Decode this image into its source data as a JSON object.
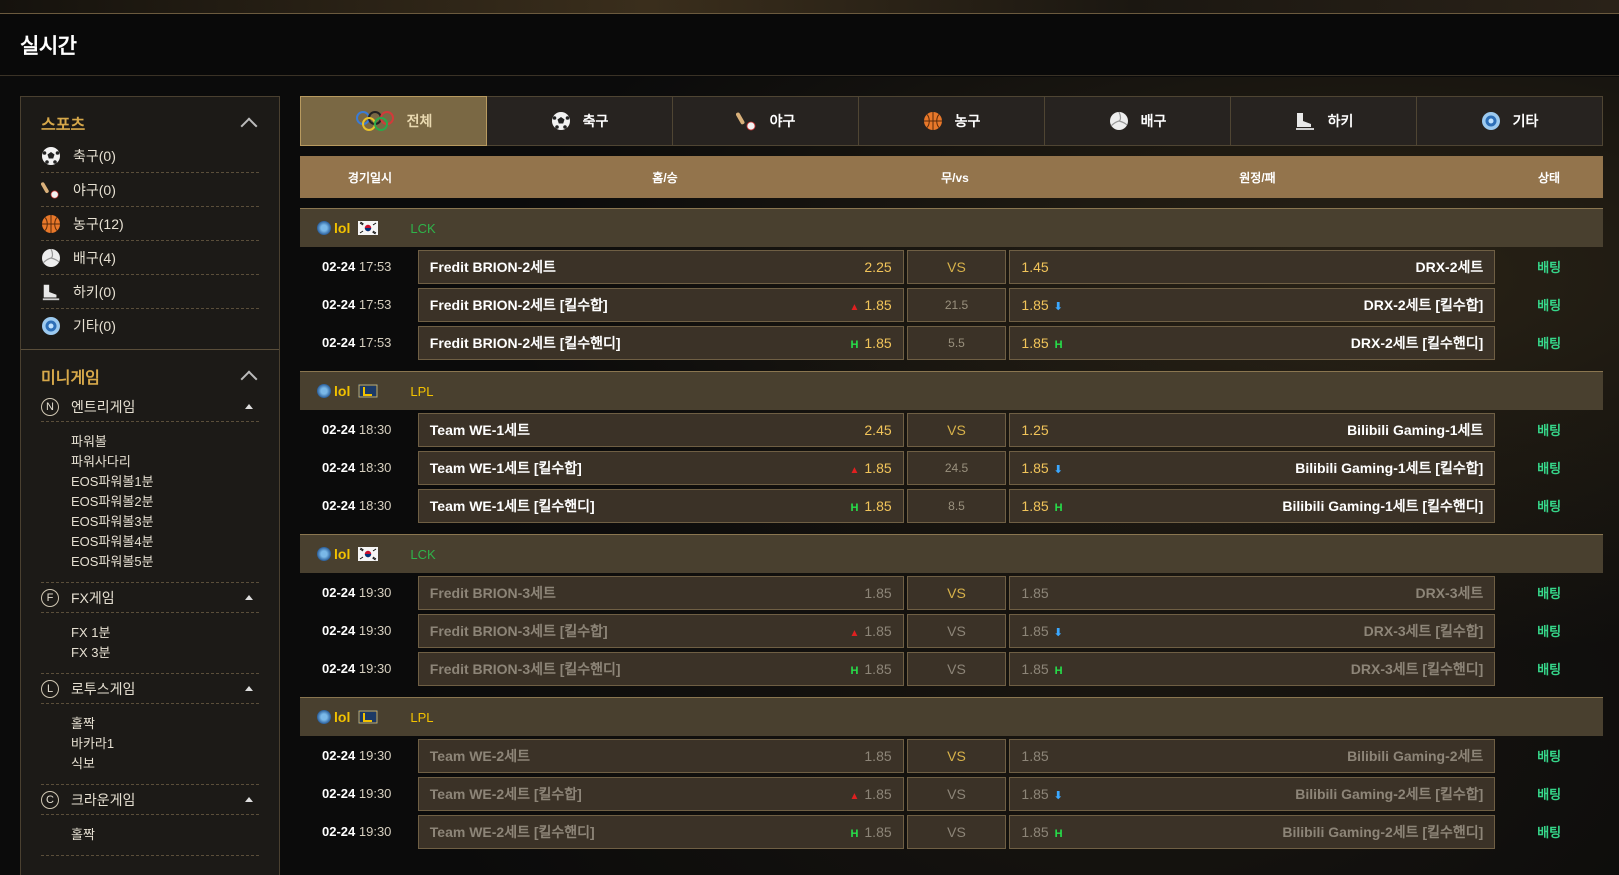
{
  "page": {
    "title": "실시간"
  },
  "sidebar": {
    "sports_title": "스포츠",
    "sports": [
      {
        "label": "축구(0)",
        "icon": "soccer-ball-icon"
      },
      {
        "label": "야구(0)",
        "icon": "baseball-icon"
      },
      {
        "label": "농구(12)",
        "icon": "basketball-icon"
      },
      {
        "label": "배구(4)",
        "icon": "volleyball-icon"
      },
      {
        "label": "하키(0)",
        "icon": "hockey-skate-icon"
      },
      {
        "label": "기타(0)",
        "icon": "etc-globe-icon"
      }
    ],
    "minigame_title": "미니게임",
    "minigames": [
      {
        "badge": "N",
        "label": "엔트리게임",
        "items": [
          "파워볼",
          "파워사다리",
          "EOS파워볼1분",
          "EOS파워볼2분",
          "EOS파워볼3분",
          "EOS파워볼4분",
          "EOS파워볼5분"
        ]
      },
      {
        "badge": "F",
        "label": "FX게임",
        "items": [
          "FX 1분",
          "FX 3분"
        ]
      },
      {
        "badge": "L",
        "label": "로투스게임",
        "items": [
          "홀짝",
          "바카라1",
          "식보"
        ]
      },
      {
        "badge": "C",
        "label": "크라운게임",
        "items": [
          "홀짝"
        ]
      }
    ]
  },
  "tabs": [
    {
      "label": "전체",
      "icon": "olympic-rings-icon",
      "active": true
    },
    {
      "label": "축구",
      "icon": "soccer-ball-icon"
    },
    {
      "label": "야구",
      "icon": "baseball-icon"
    },
    {
      "label": "농구",
      "icon": "basketball-icon"
    },
    {
      "label": "배구",
      "icon": "volleyball-icon"
    },
    {
      "label": "하키",
      "icon": "hockey-skate-icon"
    },
    {
      "label": "기타",
      "icon": "etc-globe-icon"
    }
  ],
  "table_header": {
    "date": "경기일시",
    "home": "홈/승",
    "draw": "무/vs",
    "away": "원정/패",
    "status": "상태"
  },
  "groups": [
    {
      "game": "lol",
      "league": "LCK",
      "league_color": "#2fb34a",
      "flag": "korea-flag-icon",
      "rows": [
        {
          "date": "02-24",
          "time": "17:53",
          "home": "Fredit BRION-2세트",
          "home_mark": "",
          "home_odd": "2.25",
          "mid": "VS",
          "away_odd": "1.45",
          "away_mark": "",
          "away": "DRX-2세트",
          "bet": "배팅",
          "dim": false
        },
        {
          "date": "02-24",
          "time": "17:53",
          "home": "Fredit BRION-2세트 [킬수합]",
          "home_mark": "▲",
          "home_odd": "1.85",
          "mid": "21.5",
          "away_odd": "1.85",
          "away_mark": "⬇",
          "away": "DRX-2세트 [킬수합]",
          "bet": "배팅",
          "dim": false
        },
        {
          "date": "02-24",
          "time": "17:53",
          "home": "Fredit BRION-2세트 [킬수핸디]",
          "home_mark": "H",
          "home_odd": "1.85",
          "mid": "5.5",
          "away_odd": "1.85",
          "away_mark": "H",
          "away": "DRX-2세트 [킬수핸디]",
          "bet": "배팅",
          "dim": false
        }
      ]
    },
    {
      "game": "lol",
      "league": "LPL",
      "league_color": "#f2c200",
      "flag": "lpl-logo-icon",
      "rows": [
        {
          "date": "02-24",
          "time": "18:30",
          "home": "Team WE-1세트",
          "home_mark": "",
          "home_odd": "2.45",
          "mid": "VS",
          "away_odd": "1.25",
          "away_mark": "",
          "away": "Bilibili Gaming-1세트",
          "bet": "배팅",
          "dim": false
        },
        {
          "date": "02-24",
          "time": "18:30",
          "home": "Team WE-1세트 [킬수합]",
          "home_mark": "▲",
          "home_odd": "1.85",
          "mid": "24.5",
          "away_odd": "1.85",
          "away_mark": "⬇",
          "away": "Bilibili Gaming-1세트 [킬수합]",
          "bet": "배팅",
          "dim": false
        },
        {
          "date": "02-24",
          "time": "18:30",
          "home": "Team WE-1세트 [킬수핸디]",
          "home_mark": "H",
          "home_odd": "1.85",
          "mid": "8.5",
          "away_odd": "1.85",
          "away_mark": "H",
          "away": "Bilibili Gaming-1세트 [킬수핸디]",
          "bet": "배팅",
          "dim": false
        }
      ]
    },
    {
      "game": "lol",
      "league": "LCK",
      "league_color": "#2fb34a",
      "flag": "korea-flag-icon",
      "rows": [
        {
          "date": "02-24",
          "time": "19:30",
          "home": "Fredit BRION-3세트",
          "home_mark": "",
          "home_odd": "1.85",
          "mid": "VS",
          "away_odd": "1.85",
          "away_mark": "",
          "away": "DRX-3세트",
          "bet": "배팅",
          "dim": true
        },
        {
          "date": "02-24",
          "time": "19:30",
          "home": "Fredit BRION-3세트 [킬수합]",
          "home_mark": "▲",
          "home_odd": "1.85",
          "mid": "VS",
          "away_odd": "1.85",
          "away_mark": "⬇",
          "away": "DRX-3세트 [킬수합]",
          "bet": "배팅",
          "dim": true
        },
        {
          "date": "02-24",
          "time": "19:30",
          "home": "Fredit BRION-3세트 [킬수핸디]",
          "home_mark": "H",
          "home_odd": "1.85",
          "mid": "VS",
          "away_odd": "1.85",
          "away_mark": "H",
          "away": "DRX-3세트 [킬수핸디]",
          "bet": "배팅",
          "dim": true
        }
      ]
    },
    {
      "game": "lol",
      "league": "LPL",
      "league_color": "#f2c200",
      "flag": "lpl-logo-icon",
      "rows": [
        {
          "date": "02-24",
          "time": "19:30",
          "home": "Team WE-2세트",
          "home_mark": "",
          "home_odd": "1.85",
          "mid": "VS",
          "away_odd": "1.85",
          "away_mark": "",
          "away": "Bilibili Gaming-2세트",
          "bet": "배팅",
          "dim": true
        },
        {
          "date": "02-24",
          "time": "19:30",
          "home": "Team WE-2세트 [킬수합]",
          "home_mark": "▲",
          "home_odd": "1.85",
          "mid": "VS",
          "away_odd": "1.85",
          "away_mark": "⬇",
          "away": "Bilibili Gaming-2세트 [킬수합]",
          "bet": "배팅",
          "dim": true
        },
        {
          "date": "02-24",
          "time": "19:30",
          "home": "Team WE-2세트 [킬수핸디]",
          "home_mark": "H",
          "home_odd": "1.85",
          "mid": "VS",
          "away_odd": "1.85",
          "away_mark": "H",
          "away": "Bilibili Gaming-2세트 [킬수핸디]",
          "bet": "배팅",
          "dim": true
        }
      ]
    }
  ]
}
